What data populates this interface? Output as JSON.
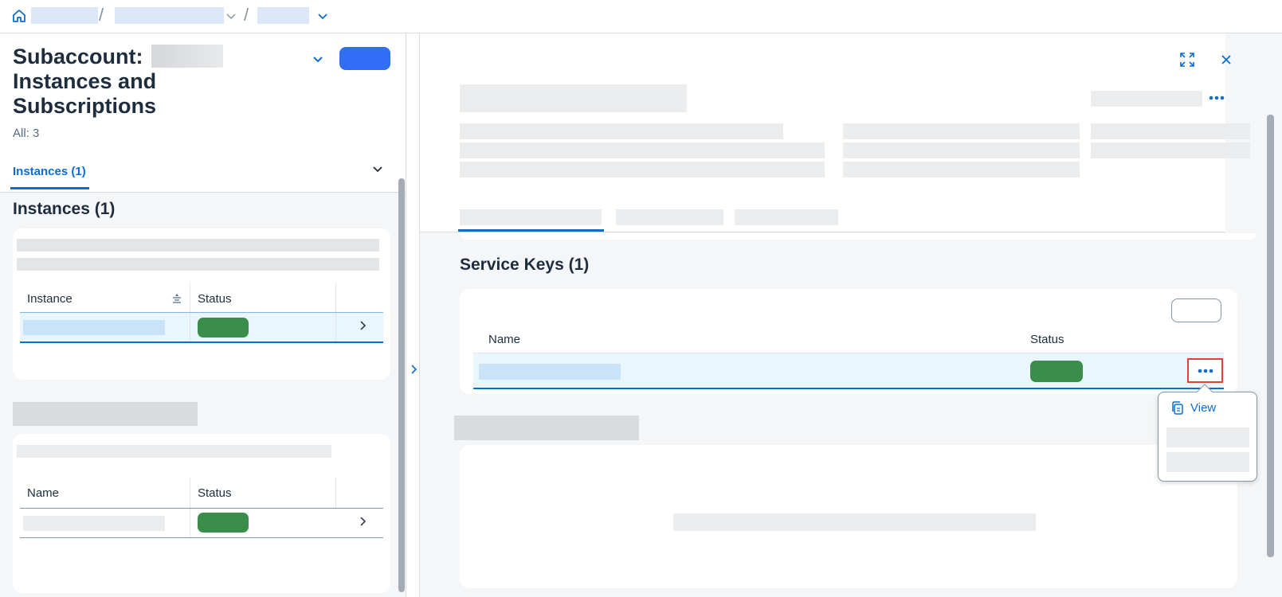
{
  "left": {
    "title": "Subaccount:",
    "title_rest_line1": "Instances and",
    "title_rest_line2": "Subscriptions",
    "count_label": "All: 3",
    "tab_label": "Instances (1)",
    "section_title": "Instances (1)",
    "instances_table": {
      "columns": [
        "Instance",
        "Status"
      ]
    },
    "second_table": {
      "columns": [
        "Name",
        "Status"
      ]
    }
  },
  "right": {
    "section_title": "Service Keys (1)",
    "keys_table": {
      "columns": [
        "Name",
        "Status"
      ]
    },
    "popover": {
      "view_label": "View"
    }
  },
  "colors": {
    "accent": "#0a6ed1",
    "status_green": "#3a8d4a",
    "highlight_border": "#e0413a",
    "row_selected": "#eaf6fd"
  },
  "icons": {
    "home": "home-icon",
    "breadcrumb_dropdown": "chevron-down-icon",
    "fullscreen": "fullscreen-icon",
    "close": "close-icon",
    "more": "more-icon",
    "copy": "copy-icon"
  }
}
